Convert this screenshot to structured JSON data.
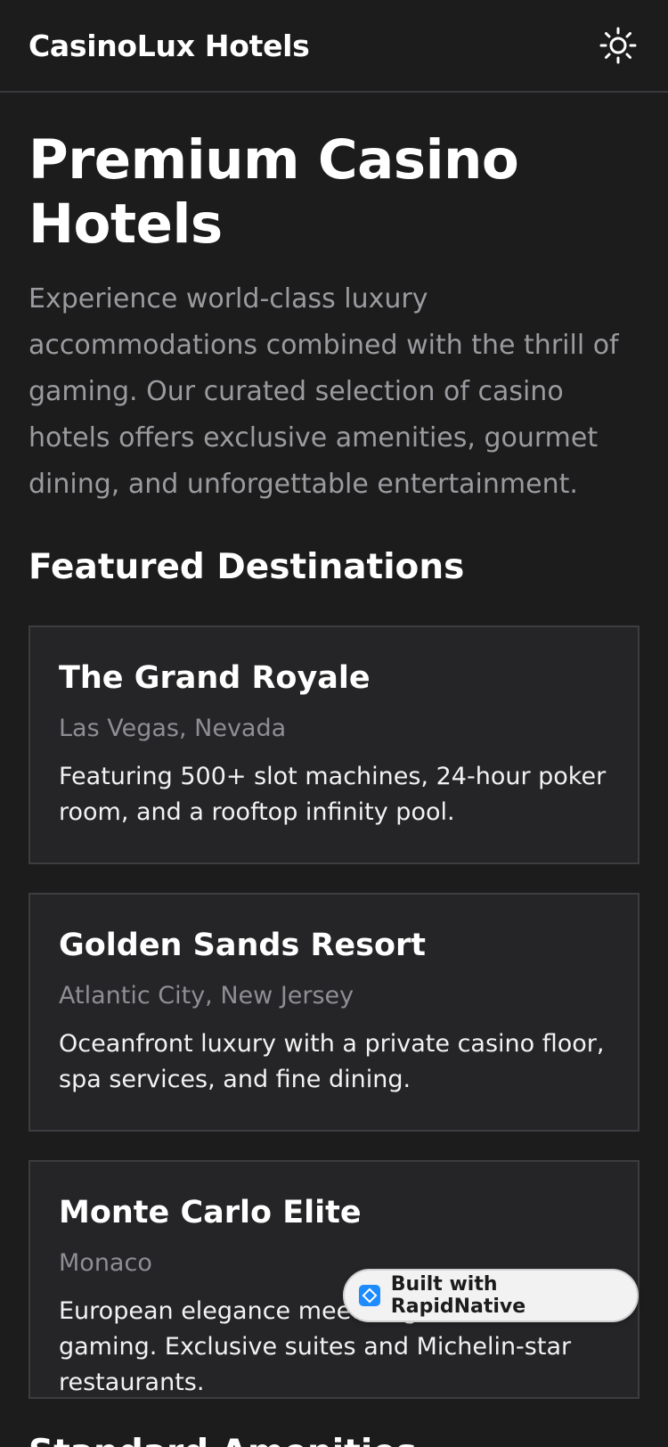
{
  "header": {
    "brand": "CasinoLux Hotels",
    "theme_icon": "sun-icon"
  },
  "hero": {
    "title": "Premium Casino Hotels",
    "description": "Experience world-class luxury accommodations combined with the thrill of gaming. Our curated selection of casino hotels offers exclusive amenities, gourmet dining, and unforgettable entertainment."
  },
  "featured": {
    "title": "Featured Destinations",
    "cards": [
      {
        "name": "The Grand Royale",
        "location": "Las Vegas, Nevada",
        "description": "Featuring 500+ slot machines, 24-hour poker room, and a rooftop infinity pool."
      },
      {
        "name": "Golden Sands Resort",
        "location": "Atlantic City, New Jersey",
        "description": "Oceanfront luxury with a private casino floor, spa services, and fine dining."
      },
      {
        "name": "Monte Carlo Elite",
        "location": "Monaco",
        "description": "European elegance meets high-stakes gaming. Exclusive suites and Michelin-star restaurants."
      }
    ]
  },
  "amenities": {
    "title": "Standard Amenities"
  },
  "badge": {
    "label": "Built with RapidNative",
    "icon": "rapidnative-logo-icon"
  },
  "colors": {
    "background": "#1c1c1d",
    "card": "#252527",
    "muted_text": "#9b9b9f",
    "badge_accent": "#1e8bff"
  }
}
